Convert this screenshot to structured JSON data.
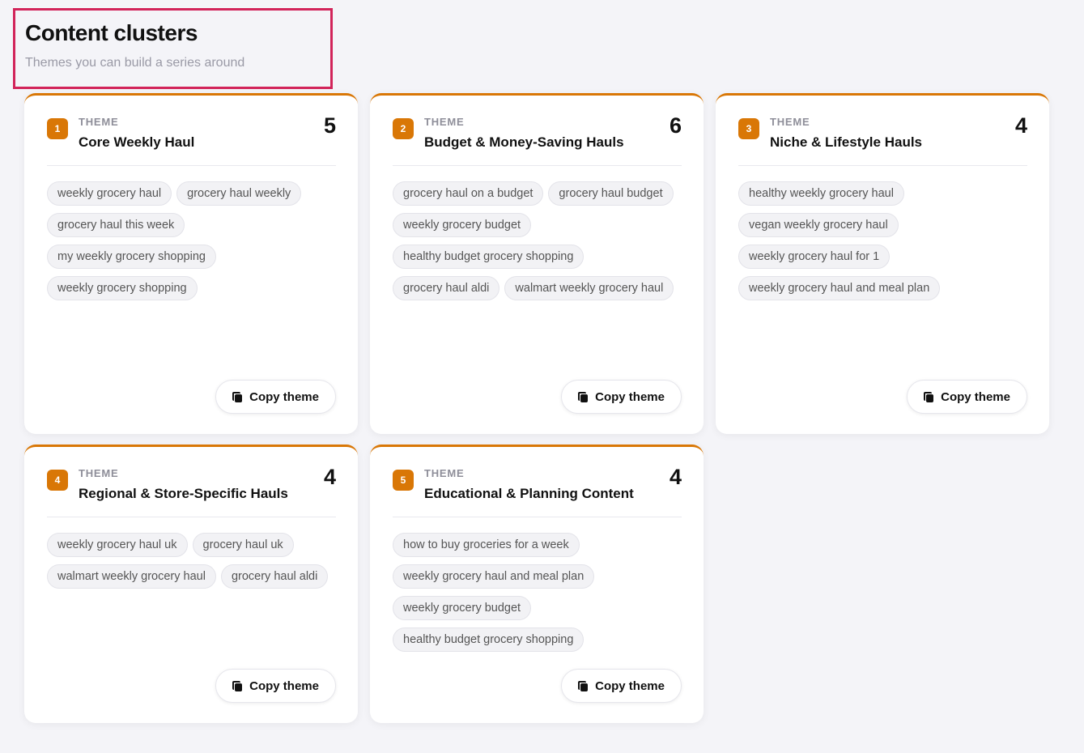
{
  "header": {
    "title": "Content clusters",
    "subtitle": "Themes you can build a series around"
  },
  "colors": {
    "accent": "#d97706",
    "highlight_border": "#d2245a"
  },
  "labels": {
    "theme": "THEME",
    "copy": "Copy theme"
  },
  "clusters": [
    {
      "number": "1",
      "title": "Core Weekly Haul",
      "count": "5",
      "tags": [
        "weekly grocery haul",
        "grocery haul weekly",
        "grocery haul this week",
        "my weekly grocery shopping",
        "weekly grocery shopping"
      ]
    },
    {
      "number": "2",
      "title": "Budget & Money-Saving Hauls",
      "count": "6",
      "tags": [
        "grocery haul on a budget",
        "grocery haul budget",
        "weekly grocery budget",
        "healthy budget grocery shopping",
        "grocery haul aldi",
        "walmart weekly grocery haul"
      ]
    },
    {
      "number": "3",
      "title": "Niche & Lifestyle Hauls",
      "count": "4",
      "tags": [
        "healthy weekly grocery haul",
        "vegan weekly grocery haul",
        "weekly grocery haul for 1",
        "weekly grocery haul and meal plan"
      ]
    },
    {
      "number": "4",
      "title": "Regional & Store-Specific Hauls",
      "count": "4",
      "tags": [
        "weekly grocery haul uk",
        "grocery haul uk",
        "walmart weekly grocery haul",
        "grocery haul aldi"
      ]
    },
    {
      "number": "5",
      "title": "Educational & Planning Content",
      "count": "4",
      "tags": [
        "how to buy groceries for a week",
        "weekly grocery haul and meal plan",
        "weekly grocery budget",
        "healthy budget grocery shopping"
      ]
    }
  ]
}
